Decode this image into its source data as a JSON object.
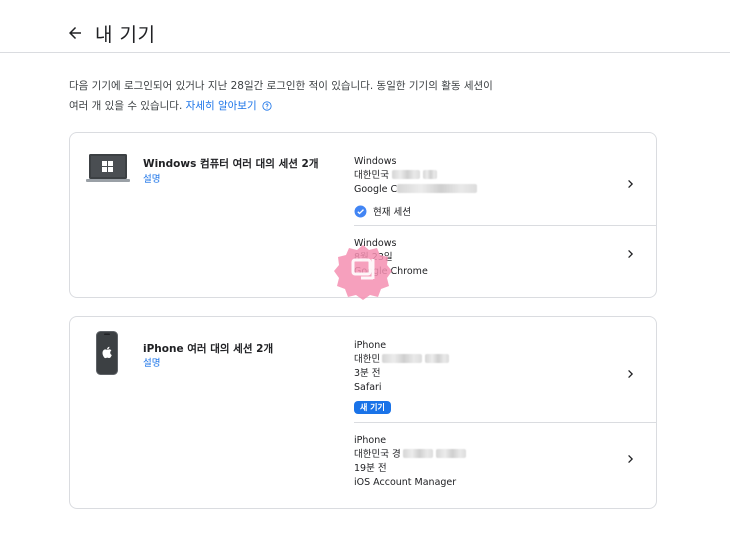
{
  "header": {
    "title": "내 기기"
  },
  "intro": {
    "text": "다음 기기에 로그인되어 있거나 지난 28일간 로그인한 적이 있습니다. 동일한 기기의 활동 세션이 여러 개 있을 수 있습니다.",
    "link": "자세히 알아보기"
  },
  "groups": [
    {
      "title": "Windows 컴퓨터 여러 대의 세션 2개",
      "desc": "설명",
      "sessions": [
        {
          "name": "Windows",
          "location": "대한민국",
          "browser": "Google C",
          "current_label": "현재 세션"
        },
        {
          "name": "Windows",
          "date": "8월 23일",
          "browser": "Google Chrome"
        }
      ]
    },
    {
      "title": "iPhone 여러 대의 세션 2개",
      "desc": "설명",
      "sessions": [
        {
          "name": "iPhone",
          "location": "대한민",
          "time": "3분 전",
          "app": "Safari",
          "badge": "새 기기"
        },
        {
          "name": "iPhone",
          "location": "대한민국 경",
          "time": "19분 전",
          "app": "iOS Account Manager"
        }
      ]
    }
  ],
  "colors": {
    "accent": "#1a73e8",
    "border": "#dadce0",
    "stamp": "#f48fb1"
  },
  "icons": [
    "back-arrow-icon",
    "help-circle-icon",
    "laptop-icon",
    "windows-logo-icon",
    "phone-icon",
    "apple-logo-icon",
    "check-circle-icon",
    "chevron-right-icon"
  ]
}
